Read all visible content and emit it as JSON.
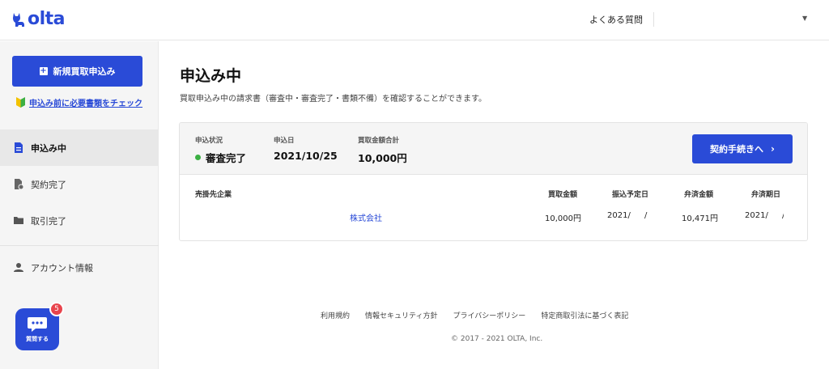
{
  "header": {
    "logo_text": "olta",
    "faq_label": "よくある質問"
  },
  "sidebar": {
    "new_application_label": "新規買取申込み",
    "check_docs_label": "申込み前に必要書類をチェック",
    "nav": [
      {
        "label": "申込み中"
      },
      {
        "label": "契約完了"
      },
      {
        "label": "取引完了"
      },
      {
        "label": "アカウント情報"
      }
    ],
    "chat": {
      "label": "質問する",
      "badge": "5"
    }
  },
  "main": {
    "title": "申込み中",
    "description": "買取申込み中の請求書（審査中・審査完了・書類不備）を確認することができます。",
    "application": {
      "status_label": "申込状況",
      "status_value": "審査完了",
      "date_label": "申込日",
      "date_value": "2021/10/25",
      "total_label": "買取金額合計",
      "total_value": "10,000円",
      "contract_button": "契約手続きへ",
      "table": {
        "headers": [
          "売掛先企業",
          "買取金額",
          "振込予定日",
          "弁済金額",
          "弁済期日"
        ],
        "rows": [
          [
            "株式会社",
            "10,000円",
            "2021/ /",
            "10,471円",
            "2021/ /"
          ]
        ]
      }
    }
  },
  "footer": {
    "links": [
      "利用規約",
      "情報セキュリティ方針",
      "プライバシーポリシー",
      "特定商取引法に基づく表記"
    ],
    "copyright": "© 2017 - 2021 OLTA, Inc."
  },
  "colors": {
    "brand": "#2a4bd7",
    "status_ok": "#3cb043",
    "badge": "#e8444d"
  }
}
